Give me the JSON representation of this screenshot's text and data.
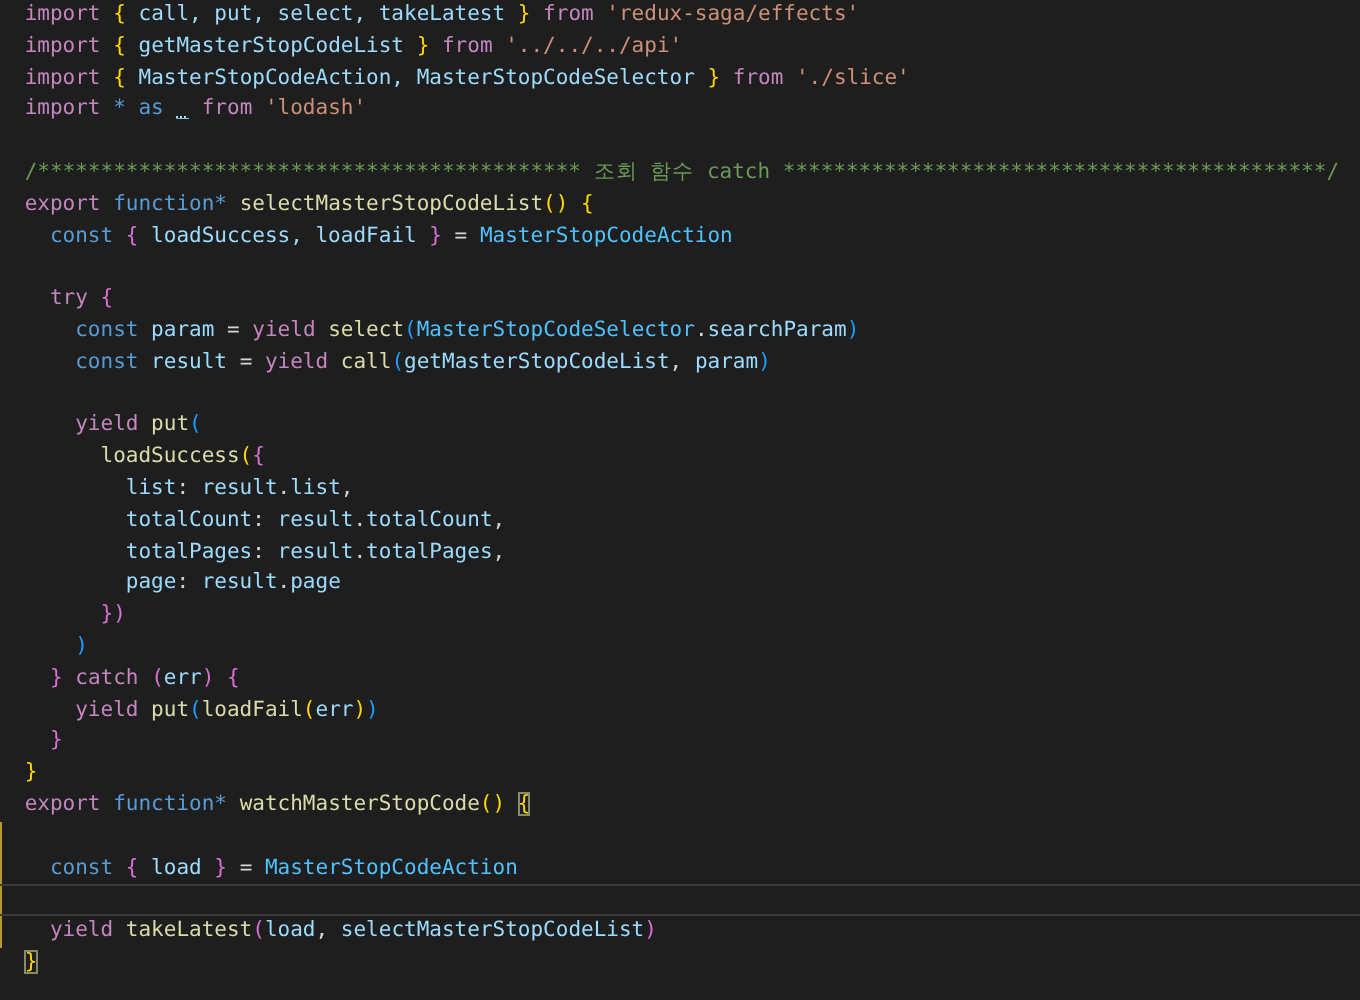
{
  "editor": {
    "lines": [
      {
        "kind": "code",
        "tokens": [
          {
            "text": "import ",
            "kind": "keyword"
          },
          {
            "text": "{",
            "kind": "b1"
          },
          {
            "text": " call, put, select, takeLatest ",
            "kind": "var"
          },
          {
            "text": "} ",
            "kind": "b1"
          },
          {
            "text": "from ",
            "kind": "keyword"
          },
          {
            "text": "'redux-saga/effects'",
            "kind": "string"
          }
        ]
      },
      {
        "kind": "code",
        "tokens": [
          {
            "text": "import ",
            "kind": "keyword"
          },
          {
            "text": "{",
            "kind": "b1"
          },
          {
            "text": " getMasterStopCodeList ",
            "kind": "var"
          },
          {
            "text": "} ",
            "kind": "b1"
          },
          {
            "text": "from ",
            "kind": "keyword"
          },
          {
            "text": "'../../../api'",
            "kind": "string"
          }
        ]
      },
      {
        "kind": "code",
        "tokens": [
          {
            "text": "import ",
            "kind": "keyword"
          },
          {
            "text": "{",
            "kind": "b1"
          },
          {
            "text": " MasterStopCodeAction, MasterStopCodeSelector ",
            "kind": "var"
          },
          {
            "text": "} ",
            "kind": "b1"
          },
          {
            "text": "from ",
            "kind": "keyword"
          },
          {
            "text": "'./slice'",
            "kind": "string"
          }
        ]
      },
      {
        "kind": "code",
        "tokens": [
          {
            "text": "import ",
            "kind": "keyword"
          },
          {
            "text": "* as ",
            "kind": "storage"
          },
          {
            "text": "_",
            "kind": "hinted"
          },
          {
            "text": " from ",
            "kind": "keyword"
          },
          {
            "text": "'lodash'",
            "kind": "string"
          }
        ]
      },
      {
        "kind": "blank"
      },
      {
        "kind": "code",
        "tokens": [
          {
            "text": "/******************************************* 조회 함수 catch *******************************************/",
            "kind": "comment"
          }
        ]
      },
      {
        "kind": "code",
        "tokens": [
          {
            "text": "export ",
            "kind": "keyword"
          },
          {
            "text": "function* ",
            "kind": "storage"
          },
          {
            "text": "selectMasterStopCodeList",
            "kind": "func"
          },
          {
            "text": "() {",
            "kind": "b1"
          }
        ]
      },
      {
        "kind": "code",
        "tokens": [
          {
            "text": "  const ",
            "kind": "storage"
          },
          {
            "text": "{",
            "kind": "b2"
          },
          {
            "text": " loadSuccess, loadFail ",
            "kind": "var"
          },
          {
            "text": "}",
            "kind": "b2"
          },
          {
            "text": " = ",
            "kind": "punct"
          },
          {
            "text": "MasterStopCodeAction",
            "kind": "const"
          }
        ]
      },
      {
        "kind": "blank"
      },
      {
        "kind": "code",
        "tokens": [
          {
            "text": "  try ",
            "kind": "keyword"
          },
          {
            "text": "{",
            "kind": "b2"
          }
        ]
      },
      {
        "kind": "code",
        "tokens": [
          {
            "text": "    const",
            "kind": "storage"
          },
          {
            "text": " param ",
            "kind": "var"
          },
          {
            "text": "= ",
            "kind": "punct"
          },
          {
            "text": "yield ",
            "kind": "keyword"
          },
          {
            "text": "select",
            "kind": "func"
          },
          {
            "text": "(",
            "kind": "b3"
          },
          {
            "text": "MasterStopCodeSelector",
            "kind": "const"
          },
          {
            "text": ".",
            "kind": "punct"
          },
          {
            "text": "searchParam",
            "kind": "var"
          },
          {
            "text": ")",
            "kind": "b3"
          }
        ]
      },
      {
        "kind": "code",
        "tokens": [
          {
            "text": "    const",
            "kind": "storage"
          },
          {
            "text": " result ",
            "kind": "var"
          },
          {
            "text": "= ",
            "kind": "punct"
          },
          {
            "text": "yield ",
            "kind": "keyword"
          },
          {
            "text": "call",
            "kind": "func"
          },
          {
            "text": "(",
            "kind": "b3"
          },
          {
            "text": "getMasterStopCodeList",
            "kind": "var"
          },
          {
            "text": ", ",
            "kind": "punct"
          },
          {
            "text": "param",
            "kind": "var"
          },
          {
            "text": ")",
            "kind": "b3"
          }
        ]
      },
      {
        "kind": "blank"
      },
      {
        "kind": "code",
        "tokens": [
          {
            "text": "    yield ",
            "kind": "keyword"
          },
          {
            "text": "put",
            "kind": "func"
          },
          {
            "text": "(",
            "kind": "b3"
          }
        ]
      },
      {
        "kind": "code",
        "tokens": [
          {
            "text": "      loadSuccess",
            "kind": "func"
          },
          {
            "text": "(",
            "kind": "b1"
          },
          {
            "text": "{",
            "kind": "b2"
          }
        ]
      },
      {
        "kind": "code",
        "tokens": [
          {
            "text": "        list",
            "kind": "var"
          },
          {
            "text": ": ",
            "kind": "punct"
          },
          {
            "text": "result",
            "kind": "var"
          },
          {
            "text": ".",
            "kind": "punct"
          },
          {
            "text": "list",
            "kind": "var"
          },
          {
            "text": ",",
            "kind": "punct"
          }
        ]
      },
      {
        "kind": "code",
        "tokens": [
          {
            "text": "        totalCount",
            "kind": "var"
          },
          {
            "text": ": ",
            "kind": "punct"
          },
          {
            "text": "result",
            "kind": "var"
          },
          {
            "text": ".",
            "kind": "punct"
          },
          {
            "text": "totalCount",
            "kind": "var"
          },
          {
            "text": ",",
            "kind": "punct"
          }
        ]
      },
      {
        "kind": "code",
        "tokens": [
          {
            "text": "        totalPages",
            "kind": "var"
          },
          {
            "text": ": ",
            "kind": "punct"
          },
          {
            "text": "result",
            "kind": "var"
          },
          {
            "text": ".",
            "kind": "punct"
          },
          {
            "text": "totalPages",
            "kind": "var"
          },
          {
            "text": ",",
            "kind": "punct"
          }
        ]
      },
      {
        "kind": "code",
        "tokens": [
          {
            "text": "        page",
            "kind": "var"
          },
          {
            "text": ": ",
            "kind": "punct"
          },
          {
            "text": "result",
            "kind": "var"
          },
          {
            "text": ".",
            "kind": "punct"
          },
          {
            "text": "page",
            "kind": "var"
          }
        ]
      },
      {
        "kind": "code",
        "tokens": [
          {
            "text": "      })",
            "kind": "b2"
          }
        ]
      },
      {
        "kind": "code",
        "tokens": [
          {
            "text": "    )",
            "kind": "b3"
          }
        ]
      },
      {
        "kind": "code",
        "tokens": [
          {
            "text": "  } ",
            "kind": "b2"
          },
          {
            "text": "catch ",
            "kind": "keyword"
          },
          {
            "text": "(",
            "kind": "b2"
          },
          {
            "text": "err",
            "kind": "var"
          },
          {
            "text": ") {",
            "kind": "b2"
          }
        ]
      },
      {
        "kind": "code",
        "tokens": [
          {
            "text": "    yield ",
            "kind": "keyword"
          },
          {
            "text": "put",
            "kind": "func"
          },
          {
            "text": "(",
            "kind": "b3"
          },
          {
            "text": "loadFail",
            "kind": "func"
          },
          {
            "text": "(",
            "kind": "b1"
          },
          {
            "text": "err",
            "kind": "var"
          },
          {
            "text": ")",
            "kind": "b1"
          },
          {
            "text": ")",
            "kind": "b3"
          }
        ]
      },
      {
        "kind": "code",
        "tokens": [
          {
            "text": "  }",
            "kind": "b2"
          }
        ]
      },
      {
        "kind": "code",
        "tokens": [
          {
            "text": "}",
            "kind": "b1"
          }
        ]
      },
      {
        "kind": "code",
        "tokens": [
          {
            "text": "export ",
            "kind": "keyword"
          },
          {
            "text": "function* ",
            "kind": "storage"
          },
          {
            "text": "watchMasterStopCode",
            "kind": "func"
          },
          {
            "text": "() ",
            "kind": "b1"
          },
          {
            "text": "{",
            "kind": "match"
          }
        ]
      },
      {
        "kind": "blank",
        "in_scope": true
      },
      {
        "kind": "code",
        "in_scope": true,
        "tokens": [
          {
            "text": "  const ",
            "kind": "storage"
          },
          {
            "text": "{",
            "kind": "b2"
          },
          {
            "text": " load ",
            "kind": "var"
          },
          {
            "text": "}",
            "kind": "b2"
          },
          {
            "text": " = ",
            "kind": "punct"
          },
          {
            "text": "MasterStopCodeAction",
            "kind": "const"
          }
        ]
      },
      {
        "kind": "blank",
        "in_scope": true,
        "current": true
      },
      {
        "kind": "code",
        "in_scope": true,
        "tokens": [
          {
            "text": "  yield ",
            "kind": "keyword"
          },
          {
            "text": "takeLatest",
            "kind": "func"
          },
          {
            "text": "(",
            "kind": "b2"
          },
          {
            "text": "load",
            "kind": "var"
          },
          {
            "text": ", ",
            "kind": "punct"
          },
          {
            "text": "selectMasterStopCodeList",
            "kind": "var"
          },
          {
            "text": ")",
            "kind": "b2"
          }
        ]
      },
      {
        "kind": "code",
        "tokens": [
          {
            "text": "}",
            "kind": "match"
          }
        ]
      }
    ]
  }
}
